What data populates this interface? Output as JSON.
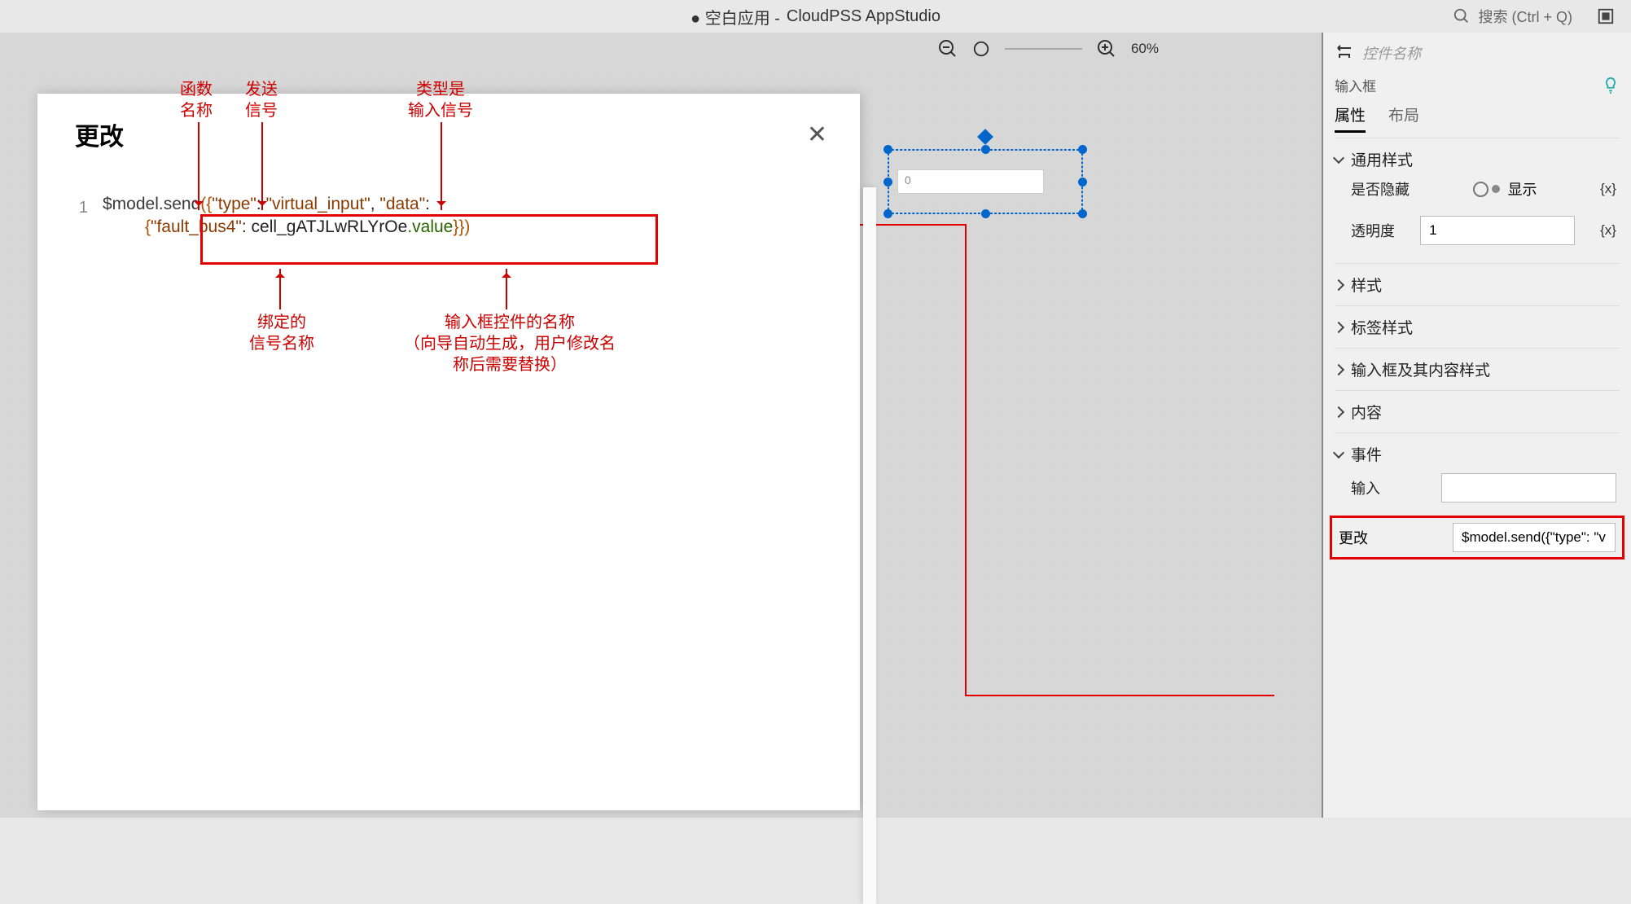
{
  "app_title_prefix": "● 空白应用 - ",
  "app_title": "CloudPSS AppStudio",
  "search_placeholder": "搜索 (Ctrl + Q)",
  "zoom_pct": "60%",
  "canvas_input_value": "0",
  "panel": {
    "head": "控件名称",
    "subtitle": "输入框",
    "tabs": {
      "attr": "属性",
      "layout": "布局"
    },
    "sections": {
      "general": "通用样式",
      "hidden_label": "是否隐藏",
      "hidden_value": "显示",
      "opacity_label": "透明度",
      "opacity_value": "1",
      "reset": "{x}",
      "style": "样式",
      "label_style": "标签样式",
      "input_style": "输入框及其内容样式",
      "content": "内容",
      "event": "事件",
      "input_evt": "输入",
      "change_evt": "更改",
      "change_val": "$model.send({\"type\": \"vi..."
    }
  },
  "modal": {
    "title": "更改",
    "line_no": "1",
    "code_line1_a": "$model",
    "code_line1_b": ".send",
    "code_line1_c": "({",
    "code_line1_d": "\"type\"",
    "code_line1_e": ": ",
    "code_line1_f": "\"virtual_input\"",
    "code_line1_g": ", ",
    "code_line1_h": "\"data\"",
    "code_line1_i": ":",
    "code_line2_a": "{",
    "code_line2_b": "\"fault_bus4\"",
    "code_line2_c": ": cell_gATJLwRLYrOe",
    "code_line2_d": ".value",
    "code_line2_e": "}})"
  },
  "annotations": {
    "fn_name": "函数\n名称",
    "send_sig": "发送\n信号",
    "type_is": "类型是\n输入信号",
    "bind_sig": "绑定的\n信号名称",
    "input_ctrl": "输入框控件的名称\n（向导自动生成，用户修改名\n称后需要替换）"
  }
}
